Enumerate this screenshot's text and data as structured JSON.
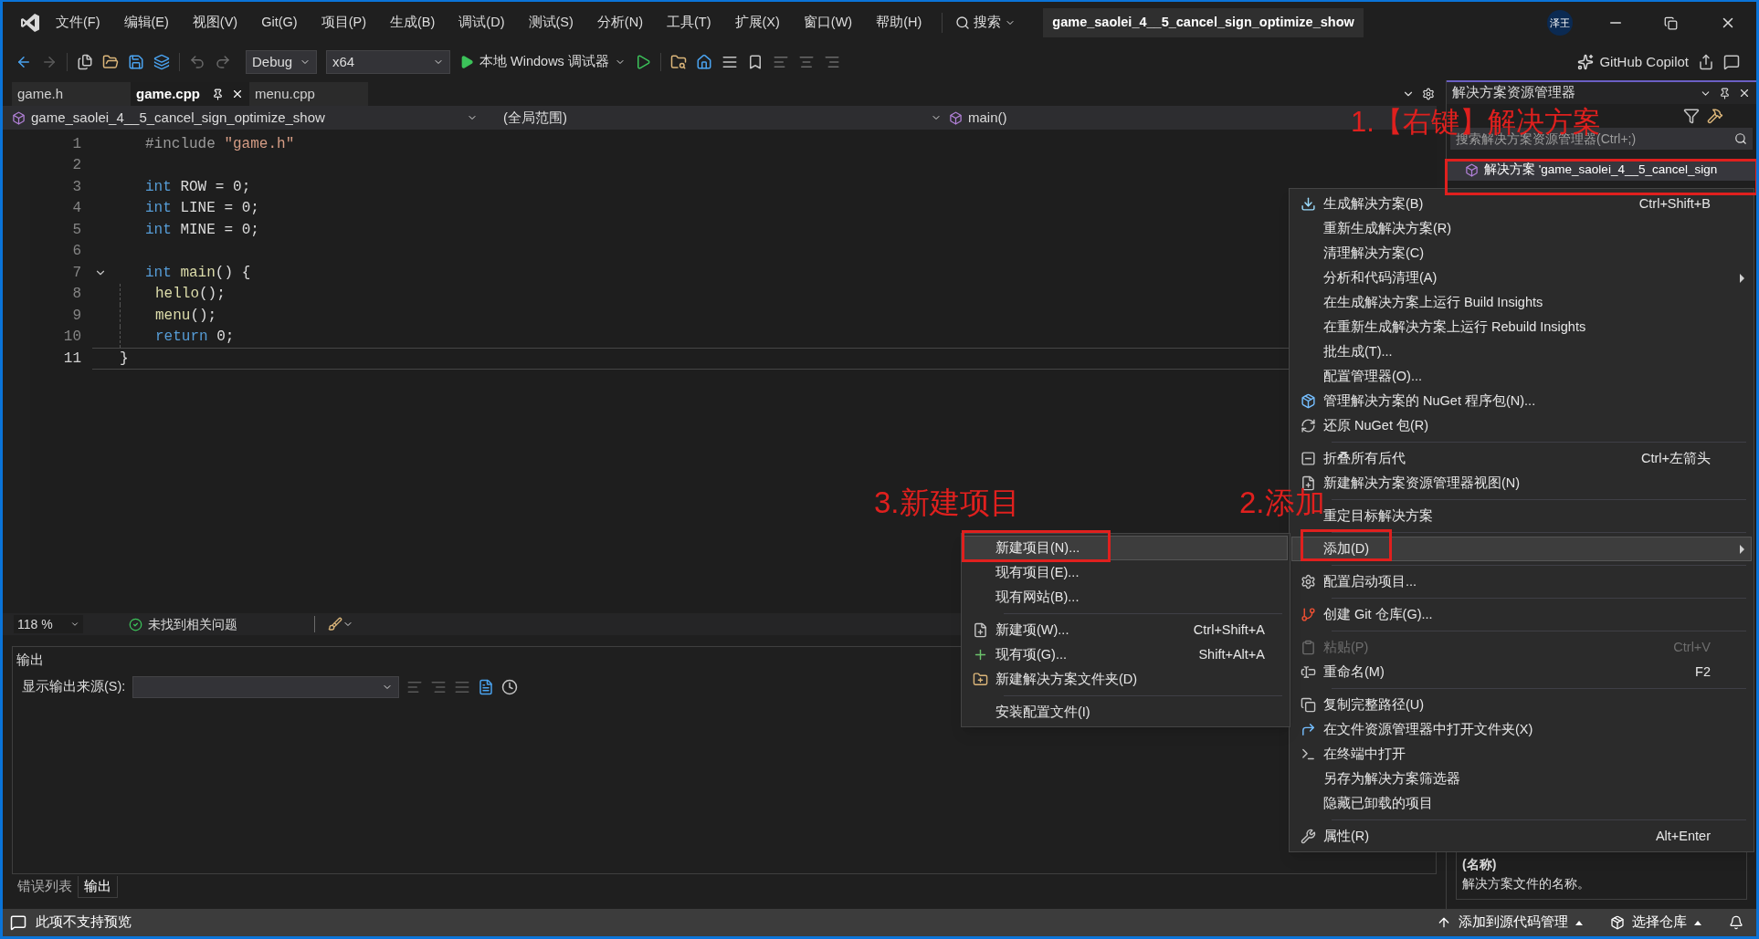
{
  "title_bar": {
    "menu": [
      "文件(F)",
      "编辑(E)",
      "视图(V)",
      "Git(G)",
      "项目(P)",
      "生成(B)",
      "调试(D)",
      "测试(S)",
      "分析(N)",
      "工具(T)",
      "扩展(X)",
      "窗口(W)",
      "帮助(H)"
    ],
    "search": "搜索",
    "solution_name": "game_saolei_4__5_cancel_sign_optimize_show",
    "account_initials": "泽王"
  },
  "toolbar": {
    "configuration": "Debug",
    "platform": "x64",
    "run_target": "本地 Windows 调试器",
    "copilot": "GitHub Copilot"
  },
  "editor_tabs": [
    {
      "label": "game.h",
      "selected": false,
      "pinned": false
    },
    {
      "label": "game.cpp",
      "selected": true,
      "pinned": true
    },
    {
      "label": "menu.cpp",
      "selected": false,
      "pinned": false
    }
  ],
  "navigation_bar": {
    "project": "game_saolei_4__5_cancel_sign_optimize_show",
    "scope": "(全局范围)",
    "member": "main()"
  },
  "code_lines": [
    {
      "number": "1",
      "indented": false,
      "foldable": false,
      "current": false,
      "tokens": [
        {
          "text": "#include",
          "kind": "preprocessor"
        },
        {
          "text": " \"game.h\"",
          "kind": "string"
        }
      ]
    },
    {
      "number": "2",
      "indented": false,
      "foldable": false,
      "current": false
    },
    {
      "number": "3",
      "indented": false,
      "foldable": false,
      "current": false,
      "tokens": [
        {
          "text": "int",
          "kind": "keyword"
        },
        {
          "text": " ROW = 0;",
          "kind": "plain"
        }
      ]
    },
    {
      "number": "4",
      "indented": false,
      "foldable": false,
      "current": false,
      "tokens": [
        {
          "text": "int",
          "kind": "keyword"
        },
        {
          "text": " LINE = 0;",
          "kind": "plain"
        }
      ]
    },
    {
      "number": "5",
      "indented": false,
      "foldable": false,
      "current": false,
      "tokens": [
        {
          "text": "int",
          "kind": "keyword"
        },
        {
          "text": " MINE = 0;",
          "kind": "plain"
        }
      ]
    },
    {
      "number": "6",
      "indented": false,
      "foldable": false,
      "current": false
    },
    {
      "number": "7",
      "indented": false,
      "foldable": true,
      "current": false,
      "tokens": [
        {
          "text": "int",
          "kind": "keyword"
        },
        {
          "text": " main",
          "kind": "function"
        },
        {
          "text": "() {",
          "kind": "plain"
        }
      ]
    },
    {
      "number": "8",
      "indented": true,
      "foldable": false,
      "current": false,
      "tokens": [
        {
          "text": "hello",
          "kind": "function"
        },
        {
          "text": "();",
          "kind": "plain"
        }
      ]
    },
    {
      "number": "9",
      "indented": true,
      "foldable": false,
      "current": false,
      "tokens": [
        {
          "text": "menu",
          "kind": "function"
        },
        {
          "text": "();",
          "kind": "plain"
        }
      ]
    },
    {
      "number": "10",
      "indented": true,
      "foldable": false,
      "current": false,
      "tokens": [
        {
          "text": "return",
          "kind": "keyword"
        },
        {
          "text": " 0;",
          "kind": "plain"
        }
      ]
    },
    {
      "number": "11",
      "indented": false,
      "foldable": false,
      "current": true,
      "tokens": [
        {
          "text": "}",
          "kind": "plain"
        }
      ]
    }
  ],
  "editor_status": {
    "zoom": "118 %",
    "issues": "未找到相关问题"
  },
  "output_panel": {
    "title": "输出",
    "source_label": "显示输出来源(S):"
  },
  "bottom_tabs": [
    {
      "label": "错误列表",
      "selected": false
    },
    {
      "label": "输出",
      "selected": true
    }
  ],
  "solution_explorer": {
    "title": "解决方案资源管理器",
    "search": {
      "placeholder": "搜索解决方案资源管理器(Ctrl+;)"
    },
    "items": [
      {
        "label": "解决方案 'game_saolei_4__5_cancel_sign"
      }
    ],
    "properties": {
      "name": "(名称)",
      "description": "解决方案文件的名称。"
    }
  },
  "context_menu": [
    {
      "kind": "item",
      "label": "生成解决方案(B)",
      "shortcut": "Ctrl+Shift+B",
      "submenu": false,
      "disabled": false,
      "selected": false
    },
    {
      "kind": "item",
      "label": "重新生成解决方案(R)",
      "submenu": false,
      "disabled": false,
      "selected": false
    },
    {
      "kind": "item",
      "label": "清理解决方案(C)",
      "submenu": false,
      "disabled": false,
      "selected": false
    },
    {
      "kind": "item",
      "label": "分析和代码清理(A)",
      "submenu": true,
      "disabled": false,
      "selected": false
    },
    {
      "kind": "item",
      "label": "在生成解决方案上运行 Build Insights",
      "submenu": false,
      "disabled": false,
      "selected": false
    },
    {
      "kind": "item",
      "label": "在重新生成解决方案上运行 Rebuild Insights",
      "submenu": false,
      "disabled": false,
      "selected": false
    },
    {
      "kind": "item",
      "label": "批生成(T)...",
      "submenu": false,
      "disabled": false,
      "selected": false
    },
    {
      "kind": "item",
      "label": "配置管理器(O)...",
      "submenu": false,
      "disabled": false,
      "selected": false
    },
    {
      "kind": "item",
      "label": "管理解决方案的 NuGet 程序包(N)...",
      "submenu": false,
      "disabled": false,
      "selected": false
    },
    {
      "kind": "item",
      "label": "还原 NuGet 包(R)",
      "submenu": false,
      "disabled": false,
      "selected": false
    },
    {
      "kind": "separator"
    },
    {
      "kind": "item",
      "label": "折叠所有后代",
      "shortcut": "Ctrl+左箭头",
      "submenu": false,
      "disabled": false,
      "selected": false
    },
    {
      "kind": "item",
      "label": "新建解决方案资源管理器视图(N)",
      "submenu": false,
      "disabled": false,
      "selected": false
    },
    {
      "kind": "separator"
    },
    {
      "kind": "item",
      "label": "重定目标解决方案",
      "submenu": false,
      "disabled": false,
      "selected": false
    },
    {
      "kind": "separator"
    },
    {
      "kind": "item",
      "label": "添加(D)",
      "submenu": true,
      "disabled": false,
      "selected": true
    },
    {
      "kind": "separator"
    },
    {
      "kind": "item",
      "label": "配置启动项目...",
      "submenu": false,
      "disabled": false,
      "selected": false
    },
    {
      "kind": "separator"
    },
    {
      "kind": "item",
      "label": "创建 Git 仓库(G)...",
      "submenu": false,
      "disabled": false,
      "selected": false
    },
    {
      "kind": "separator"
    },
    {
      "kind": "item",
      "label": "粘贴(P)",
      "shortcut": "Ctrl+V",
      "submenu": false,
      "disabled": true,
      "selected": false
    },
    {
      "kind": "item",
      "label": "重命名(M)",
      "shortcut": "F2",
      "submenu": false,
      "disabled": false,
      "selected": false
    },
    {
      "kind": "separator"
    },
    {
      "kind": "item",
      "label": "复制完整路径(U)",
      "submenu": false,
      "disabled": false,
      "selected": false
    },
    {
      "kind": "item",
      "label": "在文件资源管理器中打开文件夹(X)",
      "submenu": false,
      "disabled": false,
      "selected": false
    },
    {
      "kind": "item",
      "label": "在终端中打开",
      "submenu": false,
      "disabled": false,
      "selected": false
    },
    {
      "kind": "item",
      "label": "另存为解决方案筛选器",
      "submenu": false,
      "disabled": false,
      "selected": false
    },
    {
      "kind": "item",
      "label": "隐藏已卸载的项目",
      "submenu": false,
      "disabled": false,
      "selected": false
    },
    {
      "kind": "separator"
    },
    {
      "kind": "item",
      "label": "属性(R)",
      "shortcut": "Alt+Enter",
      "submenu": false,
      "disabled": false,
      "selected": false
    }
  ],
  "submenu": [
    {
      "kind": "item",
      "label": "新建项目(N)...",
      "selected": true
    },
    {
      "kind": "item",
      "label": "现有项目(E)...",
      "selected": false
    },
    {
      "kind": "item",
      "label": "现有网站(B)...",
      "selected": false
    },
    {
      "kind": "separator"
    },
    {
      "kind": "item",
      "label": "新建项(W)...",
      "shortcut": "Ctrl+Shift+A",
      "selected": false
    },
    {
      "kind": "item",
      "label": "现有项(G)...",
      "shortcut": "Shift+Alt+A",
      "selected": false
    },
    {
      "kind": "item",
      "label": "新建解决方案文件夹(D)",
      "selected": false
    },
    {
      "kind": "separator"
    },
    {
      "kind": "item",
      "label": "安装配置文件(I)",
      "selected": false
    }
  ],
  "annotations": [
    {
      "text": "1.【右键】解决方案"
    },
    {
      "text": "2.添加"
    },
    {
      "text": "3.新建项目"
    }
  ],
  "status_bar": {
    "message": "此项不支持预览",
    "source_control": "添加到源代码管理",
    "repository": "选择仓库"
  }
}
